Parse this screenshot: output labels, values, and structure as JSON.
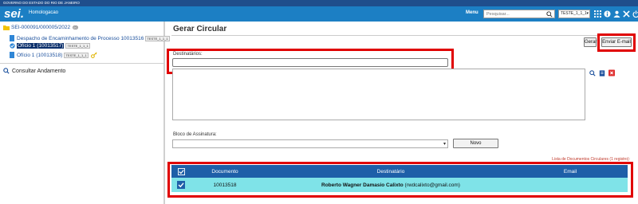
{
  "gov_bar": {
    "text": "GOVERNO DO ESTADO DO RIO DE JANEIRO"
  },
  "header": {
    "logo": "sei.",
    "environment": "Homologacao",
    "menu_label": "Menu",
    "search_placeholder": "Pesquisar...",
    "unit": "TESTE_1_1_1",
    "icons": [
      "grid-icon",
      "info-icon",
      "user-icon",
      "tools-icon",
      "power-icon"
    ],
    "color": "#1c7fc4"
  },
  "tree": {
    "process": "SEI-000091/000005/2022",
    "process_badge": "00",
    "items": [
      {
        "label": "Despacho de Encaminhamento de Processo 10013516",
        "tag": "TESTE_1_1_1",
        "selected": false
      },
      {
        "label": "Ofício 1 (10013517)",
        "tag": "TESTE_1_1_1",
        "selected": true
      },
      {
        "label": "Ofício 1 (10013518)",
        "tag": "TESTE_1_1_1",
        "selected": false
      }
    ],
    "consult": "Consultar Andamento"
  },
  "main": {
    "title": "Gerar Circular",
    "btn_gerar": "Gerar",
    "btn_email": "Enviar E-mail",
    "recipients_label": "Destinatários:",
    "bloco_label": "Bloco de Assinatura:",
    "btn_novo": "Novo",
    "list_caption": "Lista de Documentos Circulares (1 registro):",
    "table": {
      "headers": [
        "Documento",
        "Destinatário",
        "Email"
      ],
      "rows": [
        {
          "documento": "10013518",
          "destinatario_name": "Roberto Wagner Damasio Calixto",
          "destinatario_email": "(rwdcalixto@gmail.com)",
          "email": ""
        }
      ]
    },
    "accent": "#e00000"
  }
}
